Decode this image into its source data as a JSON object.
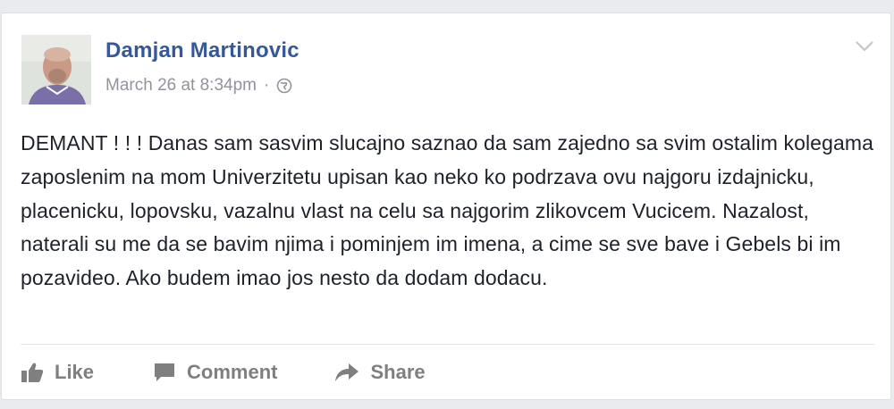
{
  "post": {
    "author_name": "Damjan Martinovic",
    "timestamp": "March 26 at 8:34pm",
    "separator": "·",
    "privacy_icon": "globe-icon",
    "menu_icon": "chevron-down-icon",
    "body_text": "DEMANT ! ! ! Danas sam sasvim slucajno saznao da sam zajedno sa svim ostalim kolegama zaposlenim na mom Univerzitetu upisan kao neko ko podrzava ovu najgoru izdajnicku, placenicku, lopovsku, vazalnu vlast na celu sa najgorim zlikovcem Vucicem. Nazalost, naterali su me da se bavim njima i pominjem im imena, a cime se sve bave i Gebels bi im pozavideo. Ako budem imao jos nesto da dodam dodacu."
  },
  "actions": {
    "like_label": "Like",
    "comment_label": "Comment",
    "share_label": "Share"
  },
  "colors": {
    "author_link": "#365899",
    "meta_text": "#90949c",
    "body_text": "#1d2129",
    "action_text": "#7f7f7f",
    "page_background": "#e9ebee"
  }
}
